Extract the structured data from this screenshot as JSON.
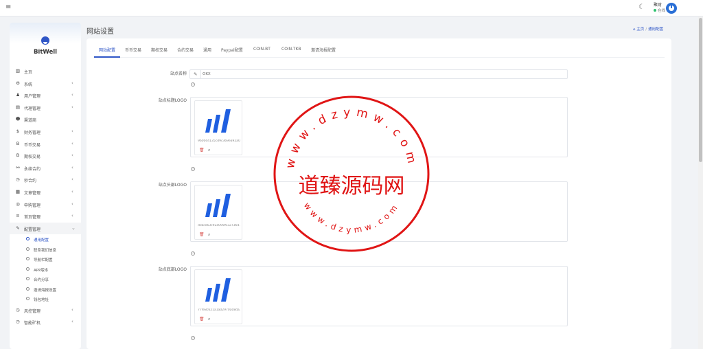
{
  "topbar": {
    "menu_icon": "hamburger-icon",
    "theme_icon": "moon-icon",
    "user_name": "聚财",
    "user_status": "在线",
    "avatar_icon": "power-avatar-icon"
  },
  "sidebar": {
    "brand": "BitWell",
    "items": [
      {
        "label": "主页",
        "icon": "dashboard-icon",
        "glyph": "▥",
        "has_children": false
      },
      {
        "label": "系统",
        "icon": "gear-icon",
        "glyph": "⚙",
        "has_children": true
      },
      {
        "label": "用户管理",
        "icon": "user-icon",
        "glyph": "♟",
        "has_children": true
      },
      {
        "label": "代理管理",
        "icon": "id-card-icon",
        "glyph": "▤",
        "has_children": true
      },
      {
        "label": "渠道商",
        "icon": "user-circle-icon",
        "glyph": "☻",
        "has_children": false
      },
      {
        "label": "财务管理",
        "icon": "dollar-icon",
        "glyph": "$",
        "has_children": true
      },
      {
        "label": "币币交易",
        "icon": "bitcoin-icon",
        "glyph": "B",
        "has_children": true
      },
      {
        "label": "期权交易",
        "icon": "bitcoin-icon",
        "glyph": "B",
        "has_children": true
      },
      {
        "label": "永续合约",
        "icon": "link-icon",
        "glyph": "⚯",
        "has_children": true
      },
      {
        "label": "秒合约",
        "icon": "clock-icon",
        "glyph": "◷",
        "has_children": true
      },
      {
        "label": "文章管理",
        "icon": "newspaper-icon",
        "glyph": "▦",
        "has_children": true
      },
      {
        "label": "申购管理",
        "icon": "life-ring-icon",
        "glyph": "◎",
        "has_children": true
      },
      {
        "label": "首页管理",
        "icon": "list-icon",
        "glyph": "≡",
        "has_children": true
      },
      {
        "label": "配置管理",
        "icon": "wrench-icon",
        "glyph": "✎",
        "has_children": true,
        "expanded": true
      }
    ],
    "sub_items": [
      {
        "label": "通用配置",
        "active": true
      },
      {
        "label": "联系我们信息",
        "active": false
      },
      {
        "label": "导航栏配置",
        "active": false
      },
      {
        "label": "APP版本",
        "active": false
      },
      {
        "label": "合约分享",
        "active": false
      },
      {
        "label": "邀请海报设置",
        "active": false
      },
      {
        "label": "钱包地址",
        "active": false
      }
    ],
    "items_after": [
      {
        "label": "风控管理",
        "icon": "clock-icon",
        "glyph": "◷",
        "has_children": true
      },
      {
        "label": "智能矿机",
        "icon": "clock-icon",
        "glyph": "◷",
        "has_children": true
      }
    ]
  },
  "page": {
    "title": "网站设置",
    "breadcrumb_home": "主页",
    "breadcrumb_current": "通用配置"
  },
  "tabs": [
    {
      "label": "网站配置",
      "active": true
    },
    {
      "label": "币币交易",
      "active": false
    },
    {
      "label": "期权交易",
      "active": false
    },
    {
      "label": "合约交易",
      "active": false
    },
    {
      "label": "通用",
      "active": false
    },
    {
      "label": "Paypal配置",
      "active": false
    },
    {
      "label": "COIN-BT",
      "active": false
    },
    {
      "label": "COIN-TKB",
      "active": false
    },
    {
      "label": "邀请海报配置",
      "active": false
    }
  ],
  "form": {
    "site_name_label": "站点名称",
    "site_name_value": "OKX",
    "logo_title_label": "站点标题LOGO",
    "logo_title_file": "9600d4135cd9c369ea92a0...",
    "logo_header_label": "站点头部LOGO",
    "logo_header_file": "dcbce63c92a095f0327364...",
    "logo_footer_label": "站点底部LOGO",
    "logo_footer_file": "77fe8c621a1a02970a08da...",
    "help_glyph": "?"
  },
  "watermark": {
    "main_text": "道臻源码网",
    "top_arc": "www.dzymw.com",
    "bottom_arc": "www.dzymw.com"
  },
  "colors": {
    "accent": "#2f56c7",
    "stamp_red": "#e01515",
    "logo_blue": "#1f5fe0"
  }
}
